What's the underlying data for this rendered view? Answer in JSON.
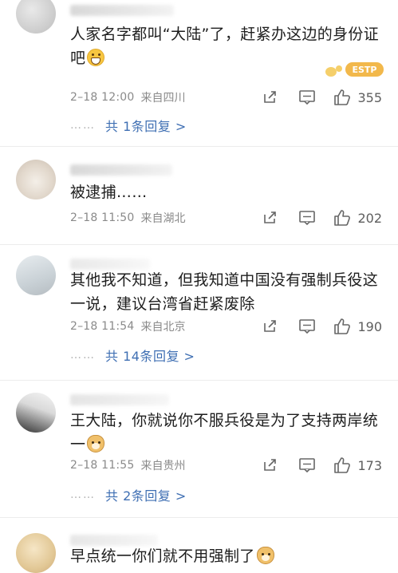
{
  "comments": [
    {
      "text": "人家名字都叫“大陆”了，赶紧办这边的身份证吧",
      "emoji": "grin-emoji",
      "time": "2–18 12:00",
      "source": "来自四川",
      "likes": "355",
      "replies": "共 1条回复 >"
    },
    {
      "text": "被逮捕……",
      "time": "2–18 11:50",
      "source": "来自湖北",
      "likes": "202"
    },
    {
      "text": "其他我不知道，但我知道中国没有强制兵役这一说，建议台湾省赶紧废除",
      "time": "2–18 11:54",
      "source": "来自北京",
      "likes": "190",
      "replies": "共 14条回复 >"
    },
    {
      "text": "王大陆，你就说你不服兵役是为了支持两岸统一",
      "emoji": "doge-emoji",
      "time": "2–18 11:55",
      "source": "来自贵州",
      "likes": "173",
      "replies": "共 2条回复 >"
    },
    {
      "text": "早点统一你们就不用强制了",
      "emoji": "doge-emoji"
    }
  ],
  "reply_dots": "……",
  "sticker": {
    "text": "ESTP",
    "color": "#f2b84b"
  },
  "colors": {
    "link": "#3f6fb3",
    "meta": "#8a8a8a",
    "divider": "#ececec"
  }
}
